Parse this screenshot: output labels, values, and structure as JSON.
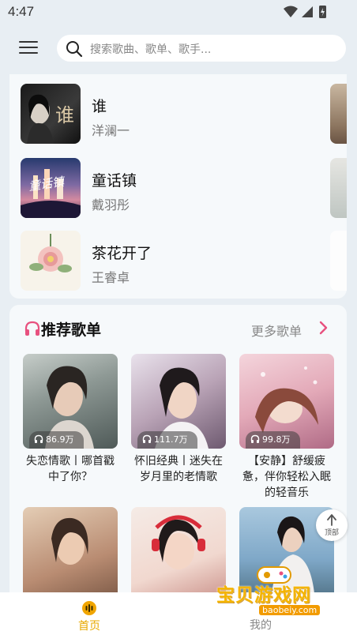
{
  "status_bar": {
    "time": "4:47"
  },
  "search": {
    "placeholder": "搜索歌曲、歌单、歌手..."
  },
  "songs": [
    {
      "title": "谁",
      "artist": "洋澜一",
      "cover_text": "谁"
    },
    {
      "title": "童话镇",
      "artist": "戴羽彤",
      "cover_text": "童话镇"
    },
    {
      "title": "茶花开了",
      "artist": "王睿卓"
    }
  ],
  "recommend": {
    "title": "推荐歌单",
    "more_label": "更多歌单",
    "playlists": [
      {
        "name": "失恋情歌丨哪首戳中了你？",
        "plays": "86.9万",
        "color": "#6f7c78"
      },
      {
        "name": "怀旧经典丨迷失在岁月里的老情歌",
        "plays": "111.7万",
        "color": "#a98e9f"
      },
      {
        "name": "【安静】舒缓疲惫，伴你轻松入眠的轻音乐",
        "plays": "99.8万",
        "color": "#d9a7b4"
      },
      {
        "color": "#b98c72"
      },
      {
        "color": "#d66b6b"
      },
      {
        "color": "#7fa8c8"
      }
    ]
  },
  "top_button": {
    "label": "顶部"
  },
  "tabs": {
    "home": "首页",
    "mine": "我的"
  },
  "watermark": {
    "text": "宝贝游戏网",
    "url": "baobeiy.com"
  },
  "colors": {
    "accent": "#f0a500",
    "pink": "#e8517f"
  }
}
